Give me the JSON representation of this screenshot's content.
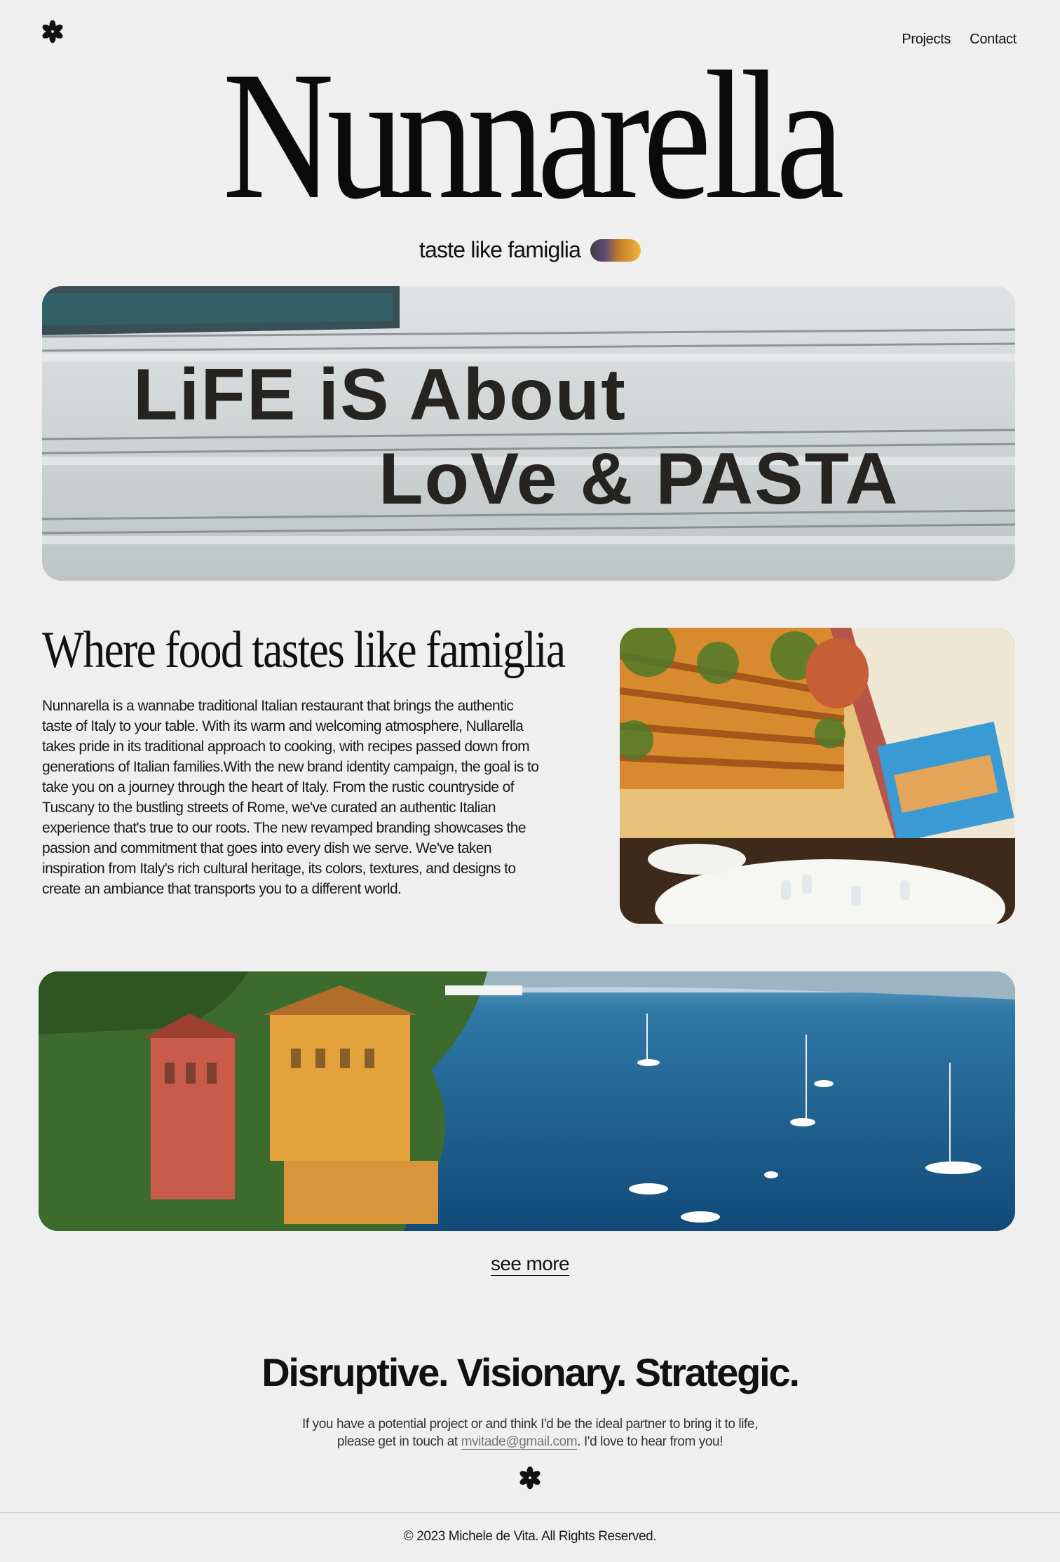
{
  "header": {
    "logo_icon": "flower-asterisk-icon",
    "nav": [
      {
        "label": "Projects"
      },
      {
        "label": "Contact"
      }
    ]
  },
  "brand": {
    "title": "Nunnarella",
    "tagline": "taste like famiglia"
  },
  "hero": {
    "painted_text_line1": "LiFE iS About",
    "painted_text_line2": "LoVe & PASTA"
  },
  "about": {
    "title": "Where food tastes like famiglia",
    "body": "Nunnarella is a wannabe traditional Italian restaurant that brings the authentic taste of Italy to your table. With its warm and welcoming atmosphere, Nullarella takes pride in its traditional approach to cooking, with recipes passed down from generations of Italian families.With the new brand identity campaign, the goal is to take you on a journey through the heart of Italy. From the rustic countryside of Tuscany to the bustling streets of Rome, we've curated an authentic Italian experience that's true to our roots. The new revamped branding showcases the passion and commitment that goes into every dish we serve. We've taken inspiration from Italy's rich cultural heritage, its colors, textures, and designs to create an ambiance that transports you to a different world."
  },
  "gallery": {
    "see_more": "see more"
  },
  "cta": {
    "title": "Disruptive. Visionary. Strategic.",
    "line1": "If you have a potential project or and think I'd be the ideal partner to bring it to life,",
    "line2_prefix": "please get in touch at ",
    "email": "mvitade@gmail.com",
    "line2_suffix": ". I'd love to hear from you!"
  },
  "footer": {
    "copyright": "© 2023 Michele de Vita. All Rights Reserved."
  },
  "colors": {
    "background": "#efefef",
    "text": "#111111",
    "muted": "#777777"
  }
}
